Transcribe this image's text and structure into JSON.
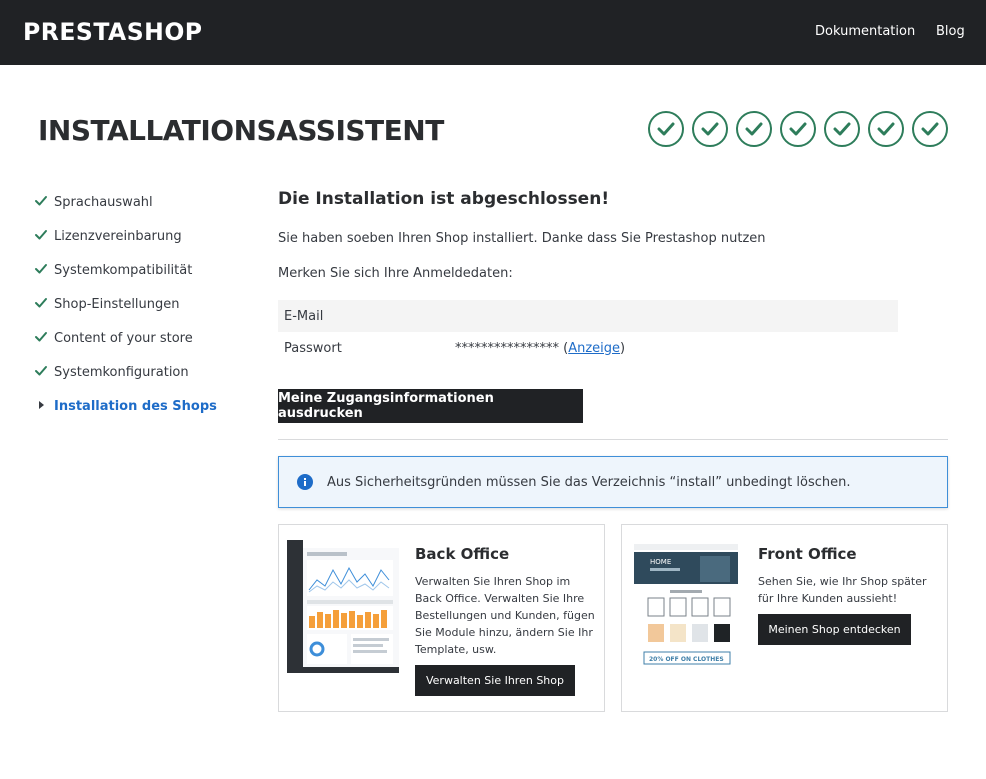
{
  "header": {
    "logo": "PRESTASHOP",
    "nav": [
      "Dokumentation",
      "Blog"
    ],
    "background": "#202225"
  },
  "page": {
    "title": "INSTALLATIONSASSISTENT",
    "steps_completed": 7,
    "step_color": "#2e7d5b"
  },
  "sidebar": {
    "items": [
      {
        "label": "Sprachauswahl",
        "state": "done",
        "icon": "check-icon"
      },
      {
        "label": "Lizenzvereinbarung",
        "state": "done",
        "icon": "check-icon"
      },
      {
        "label": "Systemkompatibilität",
        "state": "done",
        "icon": "check-icon"
      },
      {
        "label": "Shop-Einstellungen",
        "state": "done",
        "icon": "check-icon"
      },
      {
        "label": "Content of your store",
        "state": "done",
        "icon": "check-icon"
      },
      {
        "label": "Systemkonfiguration",
        "state": "done",
        "icon": "check-icon"
      },
      {
        "label": "Installation des Shops",
        "state": "active",
        "icon": "caret-right-icon"
      }
    ],
    "active_color": "#1e6cc8"
  },
  "main": {
    "heading": "Die Installation ist abgeschlossen!",
    "intro": "Sie haben soeben Ihren Shop installiert. Danke dass Sie Prestashop nutzen",
    "remember": "Merken Sie sich Ihre Anmeldedaten:",
    "credentials": {
      "email_label": "E-Mail",
      "email_value": "",
      "password_label": "Passwort",
      "password_value": "****************",
      "show_link": "Anzeige",
      "open_paren": " (",
      "close_paren": ")"
    },
    "print_button": "Meine Zugangsinformationen ausdrucken",
    "alert": {
      "icon": "info-icon",
      "text": "Aus Sicherheitsgründen müssen Sie das Verzeichnis “install” unbedingt löschen.",
      "color": "#3f8fd8"
    },
    "cards": {
      "back_office": {
        "title": "Back Office",
        "description": "Verwalten Sie Ihren Shop im Back Office. Verwalten Sie Ihre Bestellungen und Kunden, fügen Sie Module hinzu, ändern Sie Ihr Template, usw.",
        "button": "Verwalten Sie Ihren Shop"
      },
      "front_office": {
        "title": "Front Office",
        "description": "Sehen Sie, wie Ihr Shop später für Ihre Kunden aussieht!",
        "button": "Meinen Shop entdecken",
        "banner_text": "HOME",
        "promo_text": "20% OFF ON CLOTHES"
      }
    }
  }
}
